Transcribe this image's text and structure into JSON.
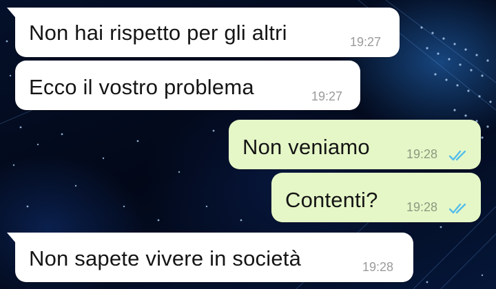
{
  "messages": [
    {
      "direction": "incoming",
      "text": "Non hai rispetto per gli altri",
      "time": "19:27"
    },
    {
      "direction": "incoming",
      "text": "Ecco il vostro problema",
      "time": "19:27"
    },
    {
      "direction": "outgoing",
      "text": "Non veniamo",
      "time": "19:28",
      "status": "read",
      "status_icon": "double-check-icon"
    },
    {
      "direction": "outgoing",
      "text": "Contenti?",
      "time": "19:28",
      "status": "read",
      "status_icon": "double-check-icon"
    },
    {
      "direction": "incoming",
      "text": "Non sapete vivere in società",
      "time": "19:28"
    }
  ],
  "colors": {
    "incoming_bubble": "#ffffff",
    "outgoing_bubble": "#e5f7c7",
    "read_ticks": "#53bdeb",
    "wallpaper": "#04102a"
  },
  "wallpaper": "dark-blue-digital-abstract"
}
